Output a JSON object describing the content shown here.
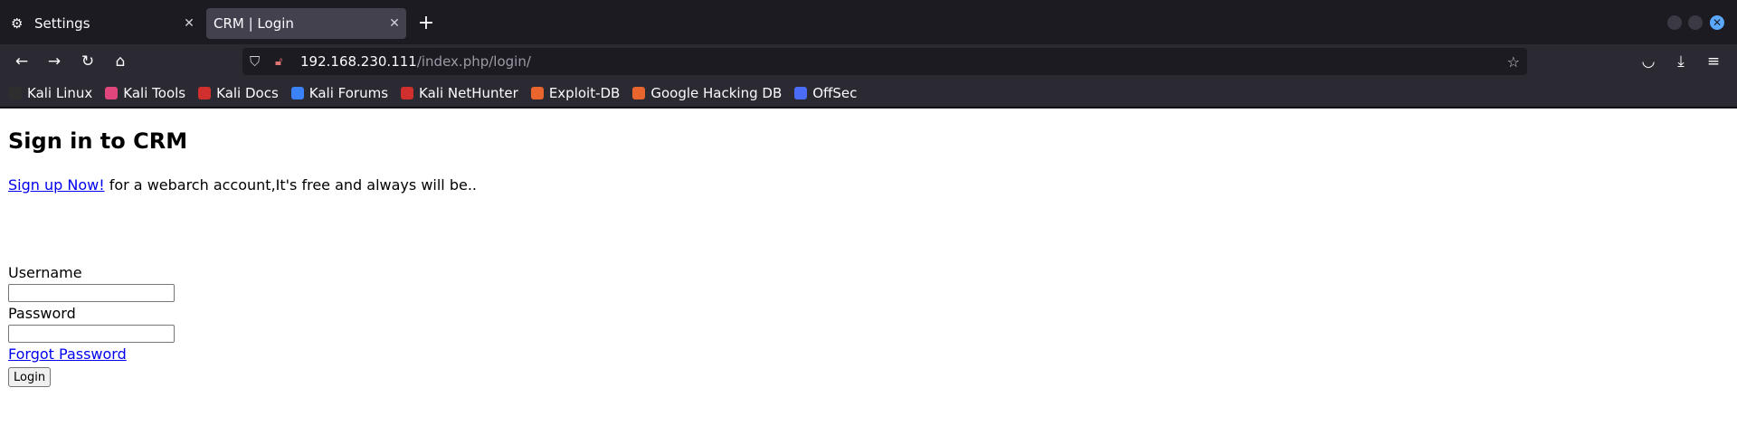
{
  "tabs": [
    {
      "label": "Settings",
      "icon": "gear-icon"
    },
    {
      "label": "CRM | Login",
      "icon": ""
    }
  ],
  "tab_close_glyph": "✕",
  "newtab_glyph": "+",
  "nav": {
    "back_glyph": "←",
    "forward_glyph": "→",
    "reload_glyph": "↻",
    "home_glyph": "⌂"
  },
  "address": {
    "host": "192.168.230.111",
    "path": "/index.php/login/"
  },
  "bookmarks": [
    {
      "label": "Kali Linux",
      "color": "#2e2e2e"
    },
    {
      "label": "Kali Tools",
      "color": "#e0457b"
    },
    {
      "label": "Kali Docs",
      "color": "#d12e2e"
    },
    {
      "label": "Kali Forums",
      "color": "#3b82f6"
    },
    {
      "label": "Kali NetHunter",
      "color": "#d12e2e"
    },
    {
      "label": "Exploit-DB",
      "color": "#e8662e"
    },
    {
      "label": "Google Hacking DB",
      "color": "#e8662e"
    },
    {
      "label": "OffSec",
      "color": "#4a6cf7"
    }
  ],
  "page": {
    "heading": "Sign in to CRM",
    "signup_link": "Sign up Now!",
    "signup_text": " for a webarch account,It's free and always will be..",
    "username_label": "Username",
    "username_value": "",
    "password_label": "Password",
    "password_value": "",
    "forgot_link": "Forgot Password ",
    "login_button": "Login"
  },
  "colors": {
    "chrome_dark": "#1c1b22",
    "toolbar": "#2b2a33",
    "active_tab": "#42414d",
    "link": "#0000ee"
  }
}
